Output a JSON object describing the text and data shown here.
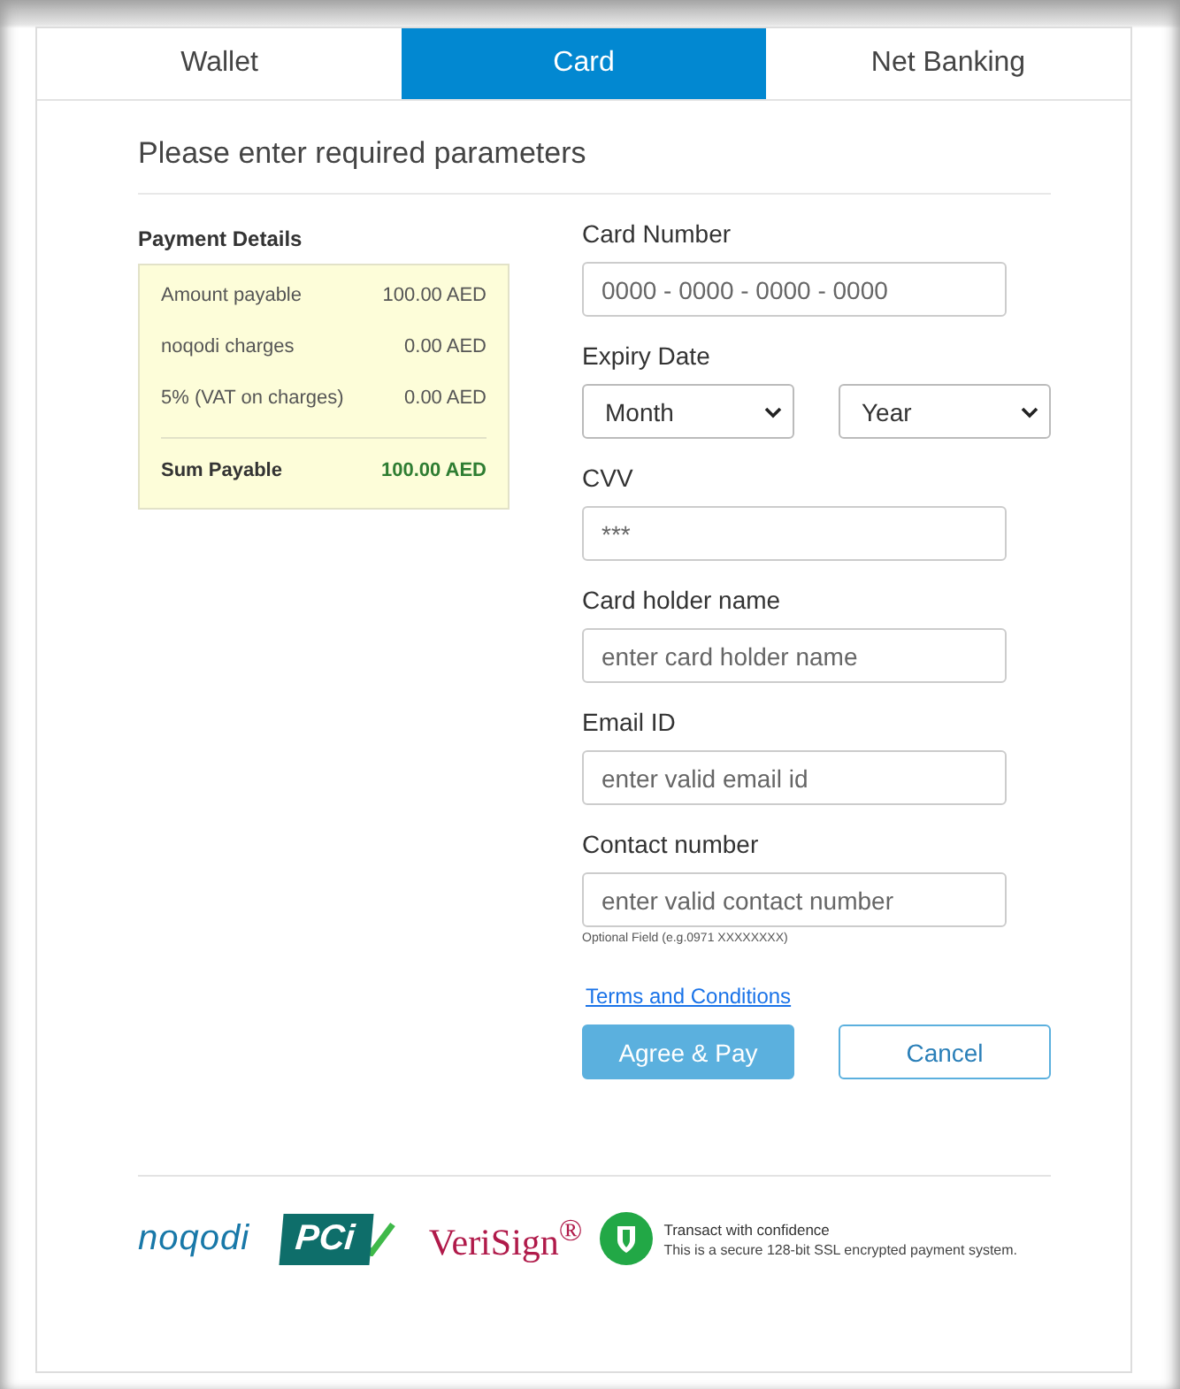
{
  "tabs": [
    {
      "label": "Wallet",
      "selected": false
    },
    {
      "label": "Card",
      "selected": true
    },
    {
      "label": "Net Banking",
      "selected": false
    }
  ],
  "heading": "Please enter required parameters",
  "payment_details": {
    "title": "Payment Details",
    "rows": [
      {
        "label": "Amount payable",
        "value": "100.00 AED",
        "kind": "line"
      },
      {
        "label": "noqodi charges",
        "value": "0.00 AED",
        "kind": "line"
      },
      {
        "label": "5% (VAT on charges)",
        "value": "0.00 AED",
        "kind": "line"
      },
      {
        "label": "Sum Payable",
        "value": "100.00 AED",
        "kind": "total"
      }
    ]
  },
  "fields": [
    {
      "kind": "input",
      "label": "Card Number",
      "placeholder": "0000 - 0000 - 0000 - 0000"
    },
    {
      "kind": "selects",
      "label": "Expiry Date",
      "selects": [
        "Month",
        "Year"
      ]
    },
    {
      "kind": "input",
      "label": "CVV",
      "placeholder": "***"
    },
    {
      "kind": "input",
      "label": "Card holder name",
      "placeholder": "enter card holder name"
    },
    {
      "kind": "input",
      "label": "Email ID",
      "placeholder": "enter valid email id"
    },
    {
      "kind": "input",
      "label": "Contact number",
      "placeholder": "enter valid contact number",
      "hint": "Optional Field (e.g.0971 XXXXXXXX)"
    }
  ],
  "terms_link": "Terms and Conditions",
  "buttons": [
    {
      "label": "Agree & Pay",
      "kind": "primary"
    },
    {
      "label": "Cancel",
      "kind": "secondary"
    }
  ],
  "footer": {
    "logos": [
      {
        "kind": "noqodi",
        "text": "noqodi"
      },
      {
        "kind": "pci",
        "text": "PCi"
      },
      {
        "kind": "verisign",
        "text": "VeriSign$^{®}$"
      }
    ],
    "secure_title": "Transact with confidence",
    "secure_text": "This is a secure 128-bit SSL encrypted payment system."
  }
}
